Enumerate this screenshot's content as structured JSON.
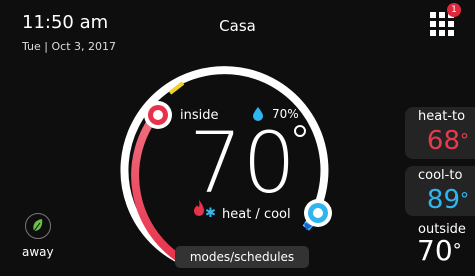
{
  "header": {
    "time": "11:50 am",
    "date": "Tue | Oct 3, 2017",
    "location": "Casa",
    "menu_badge": "1"
  },
  "dial": {
    "inside_label": "inside",
    "humidity": "70%",
    "current_temp": "70",
    "degree": "°",
    "mode_label": "heat / cool"
  },
  "setpoints": {
    "heat_label": "heat-to",
    "heat_value": "68",
    "cool_label": "cool-to",
    "cool_value": "89",
    "outside_label": "outside",
    "outside_value": "70"
  },
  "footer": {
    "away_label": "away",
    "modes_label": "modes/schedules"
  },
  "colors": {
    "heat": "#e83a4d",
    "cool": "#2fb6ee",
    "background": "#0e0e0e",
    "panel": "#242424"
  },
  "icons": {
    "menu": "grid-menu-icon",
    "humidity": "water-drop-icon",
    "heat": "flame-icon",
    "cool": "snowflake-icon",
    "away": "leaf-icon"
  }
}
